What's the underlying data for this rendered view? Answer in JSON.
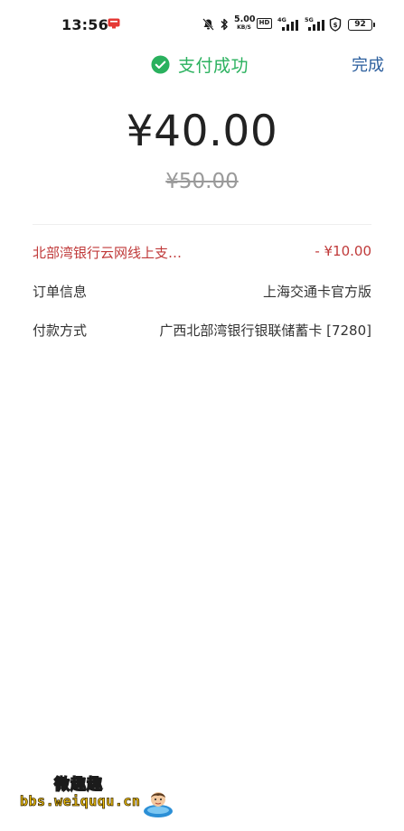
{
  "status_bar": {
    "time": "13:56",
    "net_speed_value": "5.00",
    "net_speed_unit": "KB/S",
    "hd_label": "HD",
    "signal1_label": "4G",
    "signal2_label": "5G",
    "battery": "92"
  },
  "header": {
    "title": "支付成功",
    "done_label": "完成",
    "accent_color": "#2ab15e",
    "link_color": "#2c5f9e"
  },
  "payment": {
    "amount": "¥40.00",
    "original_amount": "¥50.00"
  },
  "details": {
    "discount": {
      "label": "北部湾银行云网线上支…",
      "value": "- ¥10.00"
    },
    "order": {
      "label": "订单信息",
      "value": "上海交通卡官方版"
    },
    "payment_method": {
      "label": "付款方式",
      "value": "广西北部湾银行银联储蓄卡 [7280]"
    }
  },
  "watermark": {
    "title": "微趣趣",
    "url": "bbs.weiququ.cn"
  }
}
